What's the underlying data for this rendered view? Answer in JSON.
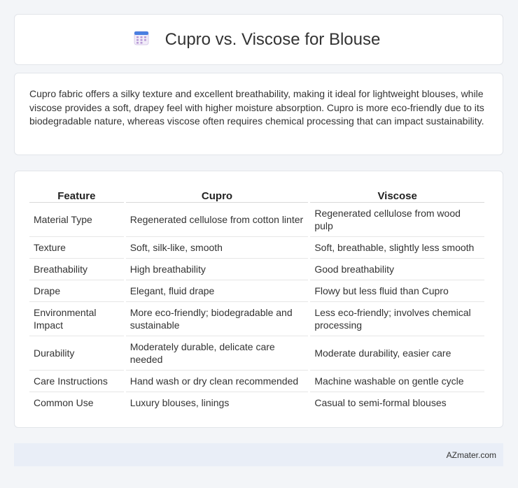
{
  "header": {
    "icon": "calendar-icon",
    "title": "Cupro vs. Viscose for Blouse"
  },
  "summary": "Cupro fabric offers a silky texture and excellent breathability, making it ideal for lightweight blouses, while viscose provides a soft, drapey feel with higher moisture absorption. Cupro is more eco-friendly due to its biodegradable nature, whereas viscose often requires chemical processing that can impact sustainability.",
  "table": {
    "headers": [
      "Feature",
      "Cupro",
      "Viscose"
    ],
    "rows": [
      [
        "Material Type",
        "Regenerated cellulose from cotton linter",
        "Regenerated cellulose from wood pulp"
      ],
      [
        "Texture",
        "Soft, silk-like, smooth",
        "Soft, breathable, slightly less smooth"
      ],
      [
        "Breathability",
        "High breathability",
        "Good breathability"
      ],
      [
        "Drape",
        "Elegant, fluid drape",
        "Flowy but less fluid than Cupro"
      ],
      [
        "Environmental Impact",
        "More eco-friendly; biodegradable and sustainable",
        "Less eco-friendly; involves chemical processing"
      ],
      [
        "Durability",
        "Moderately durable, delicate care needed",
        "Moderate durability, easier care"
      ],
      [
        "Care Instructions",
        "Hand wash or dry clean recommended",
        "Machine washable on gentle cycle"
      ],
      [
        "Common Use",
        "Luxury blouses, linings",
        "Casual to semi-formal blouses"
      ]
    ]
  },
  "footer": {
    "site": "AZmater.com"
  },
  "colors": {
    "background": "#f3f5f8",
    "card": "#ffffff",
    "footer": "#e9eef7",
    "icon_top": "#4a7fe0",
    "icon_grid": "#b89ad6"
  }
}
